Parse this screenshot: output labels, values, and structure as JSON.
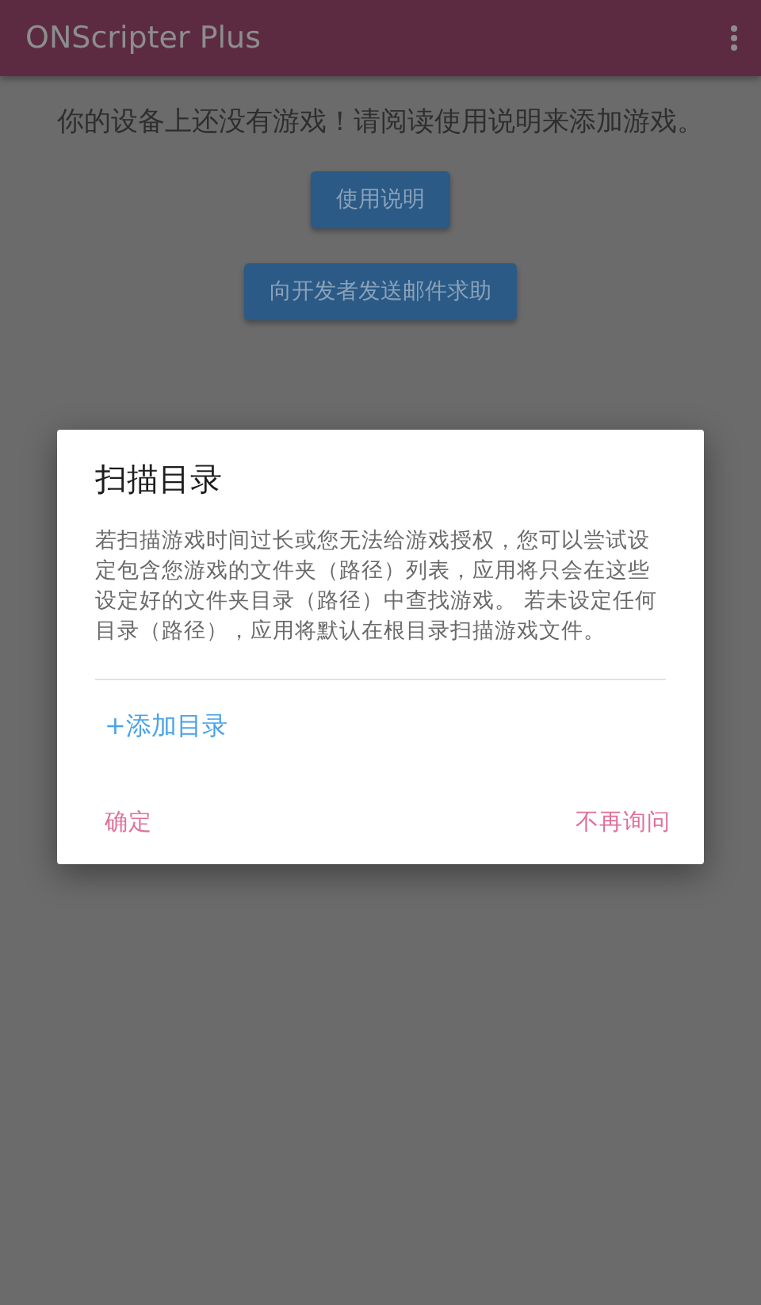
{
  "app_bar": {
    "title": "ONScripter Plus"
  },
  "message": "你的设备上还没有游戏！请阅读使用说明来添加游戏。",
  "buttons": [
    "使用说明",
    "向开发者发送邮件求助"
  ],
  "dialog": {
    "title": "扫描目录",
    "body": "若扫描游戏时间过长或您无法给游戏授权，您可以尝试设定包含您游戏的文件夹（路径）列表，应用将只会在这些设定好的文件夹目录（路径）中查找游戏。 若未设定任何目录（路径），应用将默认在根目录扫描游戏文件。",
    "add_button": "+添加目录",
    "actions": [
      "确定",
      "不再询问"
    ]
  }
}
